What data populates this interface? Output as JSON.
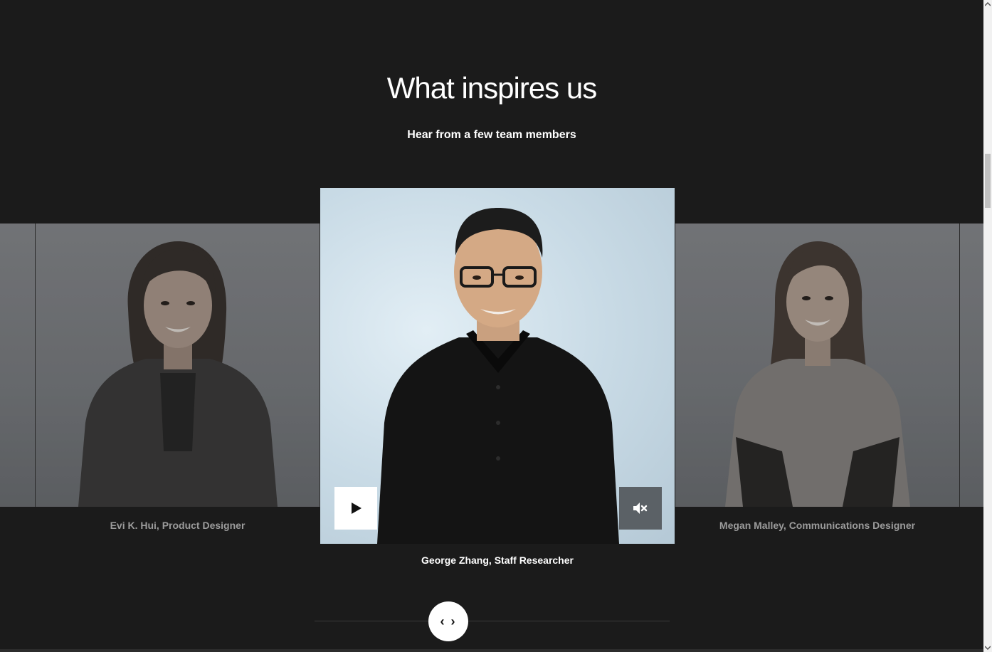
{
  "section": {
    "title": "What inspires us",
    "subtitle": "Hear from a few team members"
  },
  "carousel": {
    "members": [
      {
        "caption": "Evi K. Hui, Product Designer"
      },
      {
        "caption": "George Zhang, Staff Researcher"
      },
      {
        "caption": "Megan Malley, Communications Designer"
      }
    ],
    "active_index": 1,
    "slider_handle_glyph": "‹ ›"
  },
  "video": {
    "play_icon": "play-icon",
    "mute_icon": "volume-muted-icon"
  },
  "colors": {
    "background": "#1b1b1b",
    "mute_button": "#5b6166",
    "caption_dim": "#9b9b9b"
  }
}
